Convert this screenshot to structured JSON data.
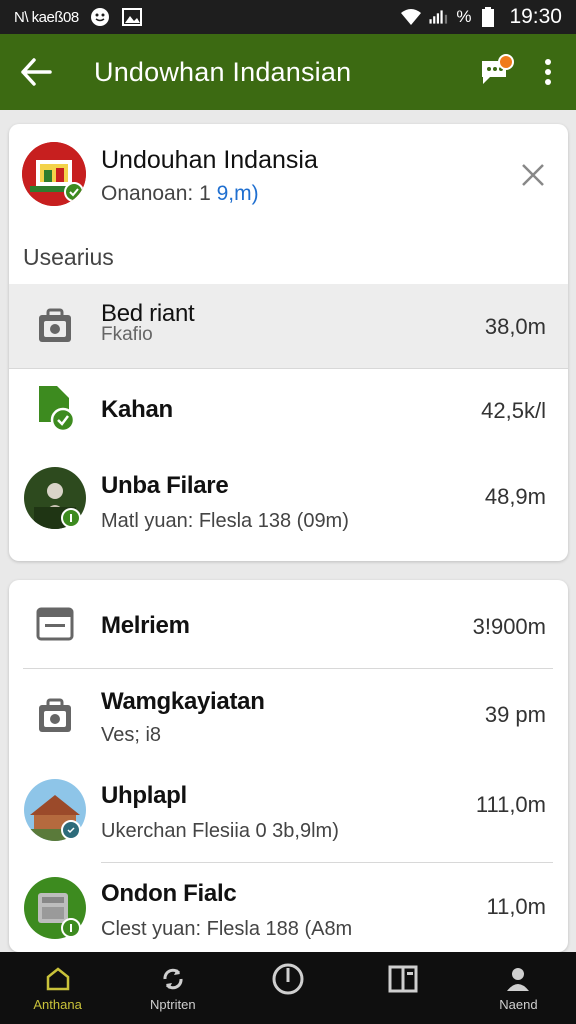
{
  "status_bar": {
    "carrier": "N\\ kaeß08",
    "battery": "%",
    "time": "19:30"
  },
  "app_bar": {
    "title": "Undowhan Indansian",
    "back_icon": "arrow-left-icon",
    "chat_icon": "chat-icon",
    "more_icon": "more-vertical-icon"
  },
  "header": {
    "title": "Undouhan Indansia",
    "subtitle_prefix": "Onanoan: 1 ",
    "subtitle_accent": "9,m)",
    "accent_color": "#1f6fd0"
  },
  "section_label": "Usearius",
  "list_primary": [
    {
      "title": "Bed riant",
      "sub": "Fkafio",
      "size": "38,0m",
      "icon": "camera-bag-icon"
    },
    {
      "title": "Kahan",
      "sub": "",
      "size": "42,5k/l",
      "icon": "file-check-icon"
    },
    {
      "title": "Unba Filare",
      "sub": "Matl yuan: Flesla 138 (09m)",
      "size": "48,9m",
      "icon": "photo-avatar"
    }
  ],
  "list_secondary": [
    {
      "title": "Melriem",
      "sub": "",
      "size": "3!900m",
      "icon": "message-box-icon"
    },
    {
      "title": "Wamgkayiatan",
      "sub": "Ves; i8",
      "size": "39 pm",
      "icon": "camera-bag-icon"
    },
    {
      "title": "Uhplapl",
      "sub": "Ukerchan Flesiia 0 3b,9lm)",
      "size": "111,0m",
      "icon": "photo-avatar"
    },
    {
      "title": "Ondon Fialc",
      "sub": "Clest yuan: Flesla 188 (A8m",
      "size": "11,0m",
      "icon": "photo-avatar"
    }
  ],
  "bottom_nav": [
    {
      "label": "Anthana",
      "icon": "home-icon",
      "active": true
    },
    {
      "label": "Nptriten",
      "icon": "sync-icon",
      "active": false
    },
    {
      "label": "",
      "icon": "compass-icon",
      "active": false
    },
    {
      "label": "",
      "icon": "book-icon",
      "active": false
    },
    {
      "label": "Naend",
      "icon": "person-icon",
      "active": false
    }
  ],
  "colors": {
    "app_bar": "#3c6a12",
    "accent_green": "#3d8b1f",
    "nav_active": "#c9c23a",
    "badge_orange": "#f07a1b"
  }
}
